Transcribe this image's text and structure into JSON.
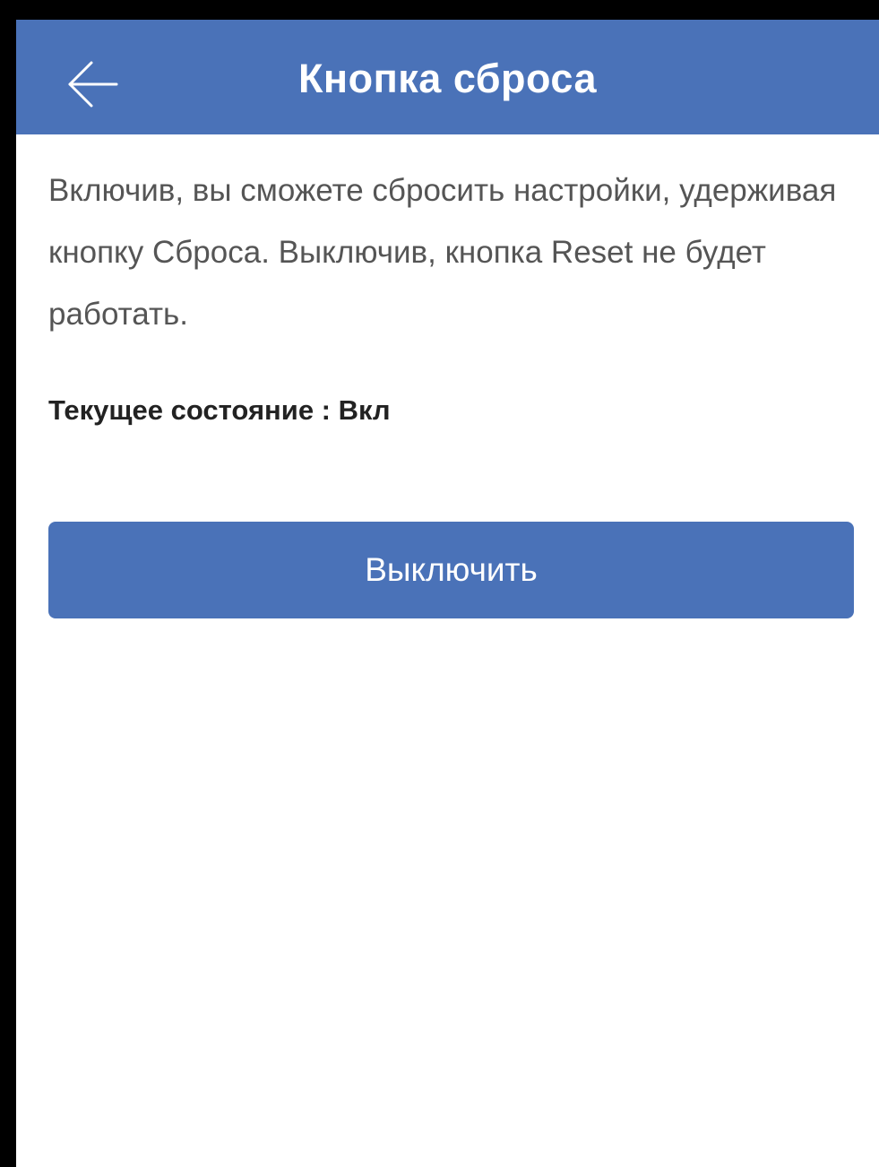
{
  "header": {
    "back_icon": "arrow-left-icon",
    "title": "Кнопка сброса"
  },
  "content": {
    "description": "Включив, вы сможете сбросить настройки, удерживая кнопку Сброса. Выключив, кнопка Reset не будет работать.",
    "status_label": "Текущее состояние :",
    "status_value": "Вкл",
    "action_button_label": "Выключить"
  },
  "colors": {
    "accent": "#4a72b8",
    "header_text": "#ffffff",
    "body_text": "#555555",
    "status_text": "#222222"
  }
}
